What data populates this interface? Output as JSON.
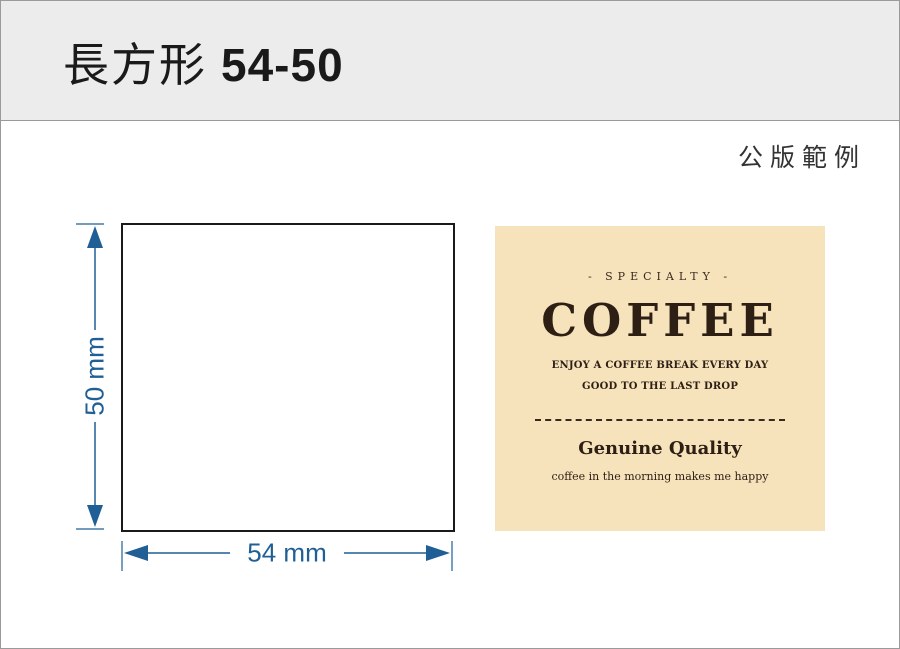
{
  "header": {
    "title_cjk": "長方形",
    "title_code": "54-50"
  },
  "sample_label": "公版範例",
  "dimensions": {
    "height_label": "50 mm",
    "width_label": "54 mm",
    "line_color": "#1f5f95"
  },
  "sample": {
    "specialty": "- SPECIALTY -",
    "headline": "COFFEE",
    "line1": "ENJOY A COFFEE BREAK EVERY DAY",
    "line2": "GOOD TO THE LAST DROP",
    "quality": "Genuine Quality",
    "tagline": "coffee in the morning makes me happy",
    "background_color": "#f6e3bb",
    "text_color": "#2d1f14"
  }
}
